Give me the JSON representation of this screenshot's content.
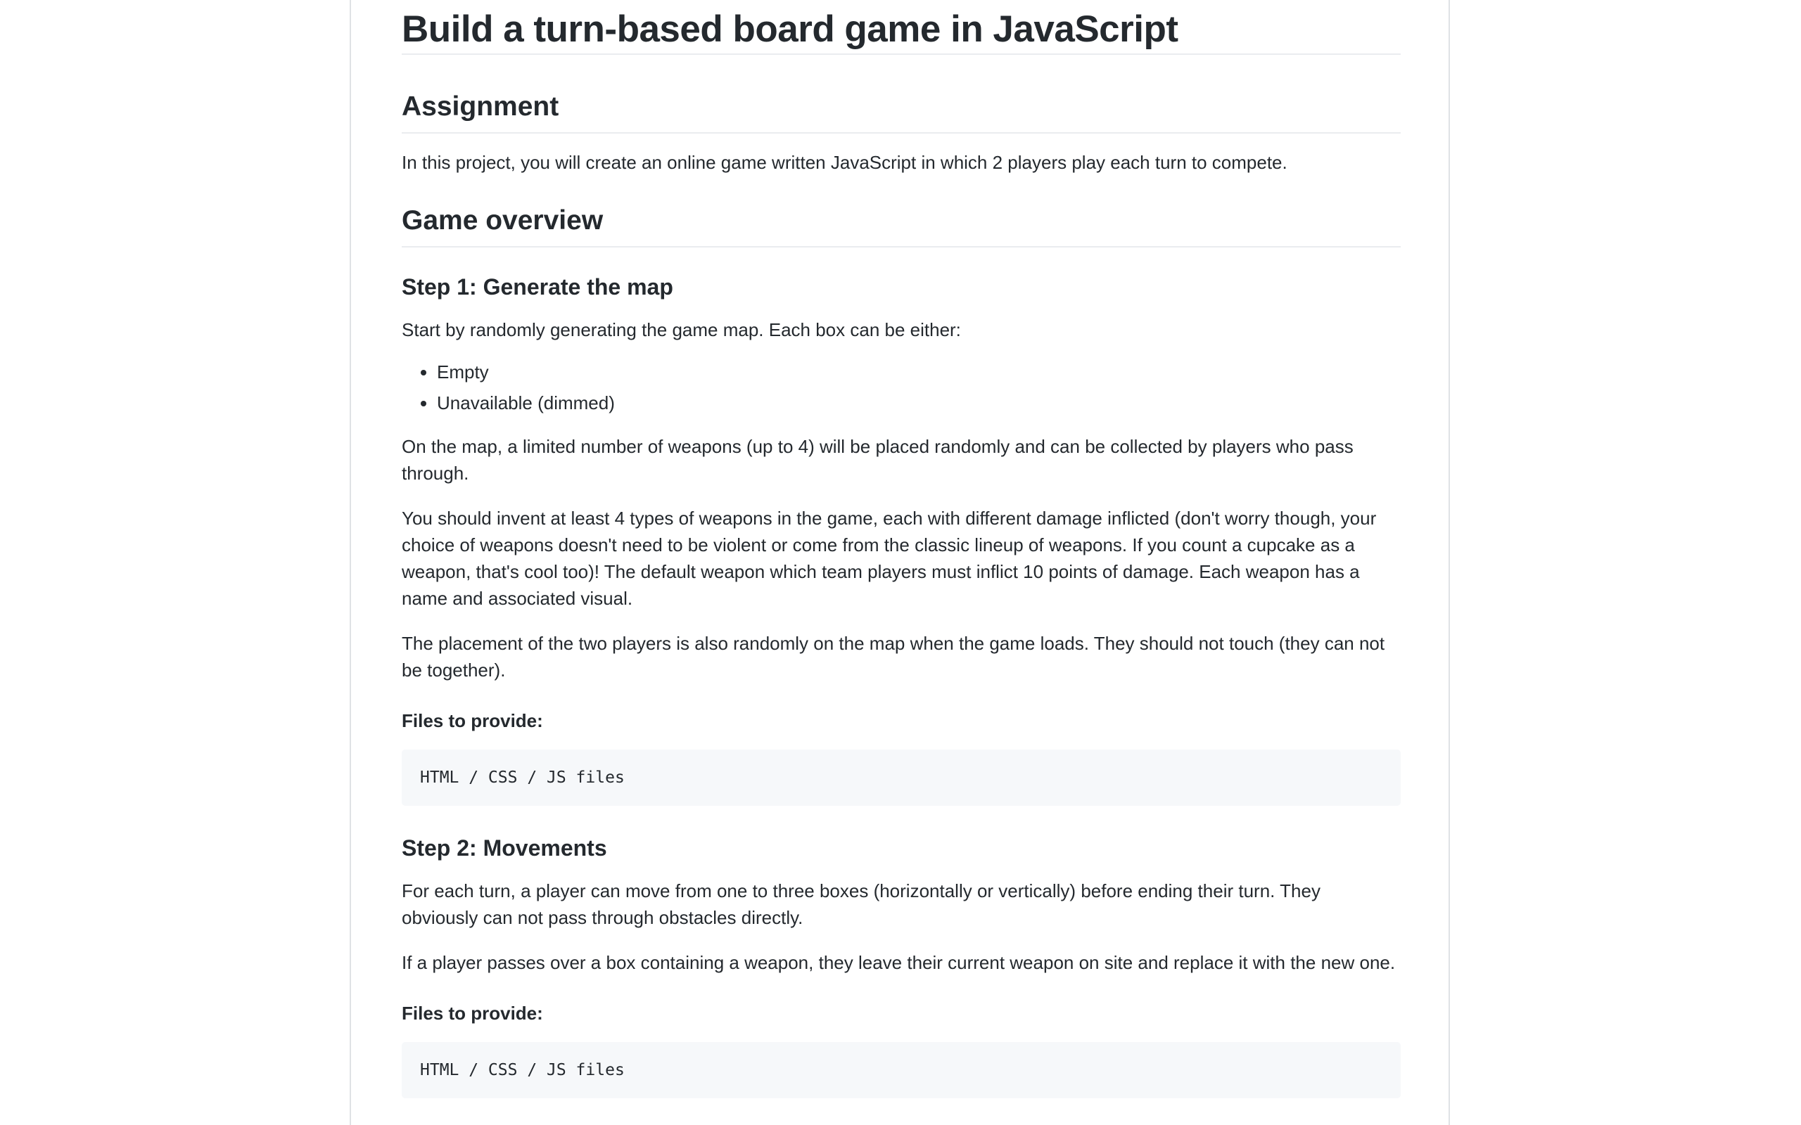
{
  "title": "Build a turn-based board game in JavaScript",
  "assignment": {
    "heading": "Assignment",
    "text": "In this project, you will create an online game written JavaScript in which 2 players play each turn to compete."
  },
  "overview": {
    "heading": "Game overview"
  },
  "step1": {
    "heading": "Step 1: Generate the map",
    "intro": "Start by randomly generating the game map. Each box can be either:",
    "items": [
      "Empty",
      "Unavailable (dimmed)"
    ],
    "para1": "On the map, a limited number of weapons (up to 4) will be placed randomly and can be collected by players who pass through.",
    "para2": "You should invent at least 4 types of weapons in the game, each with different damage inflicted (don't worry though, your choice of weapons doesn't need to be violent or come from the classic lineup of weapons. If you count a cupcake as a weapon, that's cool too)! The default weapon which team players must inflict 10 points of damage. Each weapon has a name and associated visual.",
    "para3": "The placement of the two players is also randomly on the map when the game loads. They should not touch (they can not be together).",
    "files_label": "Files to provide:",
    "files_code": "HTML / CSS / JS files"
  },
  "step2": {
    "heading": "Step 2: Movements",
    "para1": "For each turn, a player can move from one to three boxes (horizontally or vertically) before ending their turn. They obviously can not pass through obstacles directly.",
    "para2": "If a player passes over a box containing a weapon, they leave their current weapon on site and replace it with the new one.",
    "files_label": "Files to provide:",
    "files_code": "HTML / CSS / JS files"
  }
}
